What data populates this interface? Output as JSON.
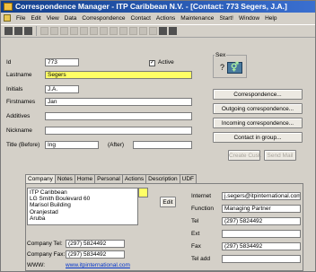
{
  "window": {
    "title": "Correspondence Manager - ITP Caribbean N.V. - [Contact: 773 Segers, J.A.]"
  },
  "menu": [
    "File",
    "Edit",
    "View",
    "Data",
    "Correspondence",
    "Contact",
    "Actions",
    "Maintenance",
    "Start!",
    "Window",
    "Help"
  ],
  "form": {
    "id_label": "Id",
    "id_value": "773",
    "active_label": "Active",
    "active_checked": true,
    "lastname_label": "Lastname",
    "lastname_value": "Segers",
    "initials_label": "Initials",
    "initials_value": "J.A.",
    "firstnames_label": "Firstnames",
    "firstnames_value": "Jan",
    "additives_label": "Additives",
    "additives_value": "",
    "nickname_label": "Nickname",
    "nickname_value": "",
    "title_before_label": "Title (Before)",
    "title_before_value": "Ing",
    "title_after_label": "(After)",
    "title_after_value": ""
  },
  "sex": {
    "label": "Sex",
    "value": "?"
  },
  "buttons": {
    "correspondence": "Correspondence...",
    "outgoing": "Outgoing correspondence...",
    "incoming": "Incoming correspondence...",
    "contact_in_group": "Contact in group...",
    "create_cust": "Create Cust.",
    "send_mail": "Send Mail",
    "edit": "Edit"
  },
  "tabs": [
    "Company",
    "Notes",
    "Home",
    "Personal",
    "Actions",
    "Description",
    "UDF"
  ],
  "company": {
    "address_lines": [
      "ITP Caribbean",
      "LG Smith Boulevard 60",
      "Marisol Building",
      "Oranjestad",
      "Aruba"
    ],
    "tel_label": "Company Tel:",
    "tel_value": "(297) 5824492",
    "fax_label": "Company Fax:",
    "fax_value": "(297) 5834492",
    "www_label": "WWW:",
    "www_value": "www.itpinternational.com"
  },
  "contact": {
    "internet_label": "Internet",
    "internet_value": "j.segers@itpinternational.com",
    "function_label": "Function",
    "function_value": "Managing Partner",
    "tel_label": "Tel",
    "tel_value": "(297) 5824492",
    "ext_label": "Ext",
    "ext_value": "",
    "fax_label": "Fax",
    "fax_value": "(297) 5834492",
    "tel_add_label": "Tel add",
    "tel_add_value": ""
  }
}
